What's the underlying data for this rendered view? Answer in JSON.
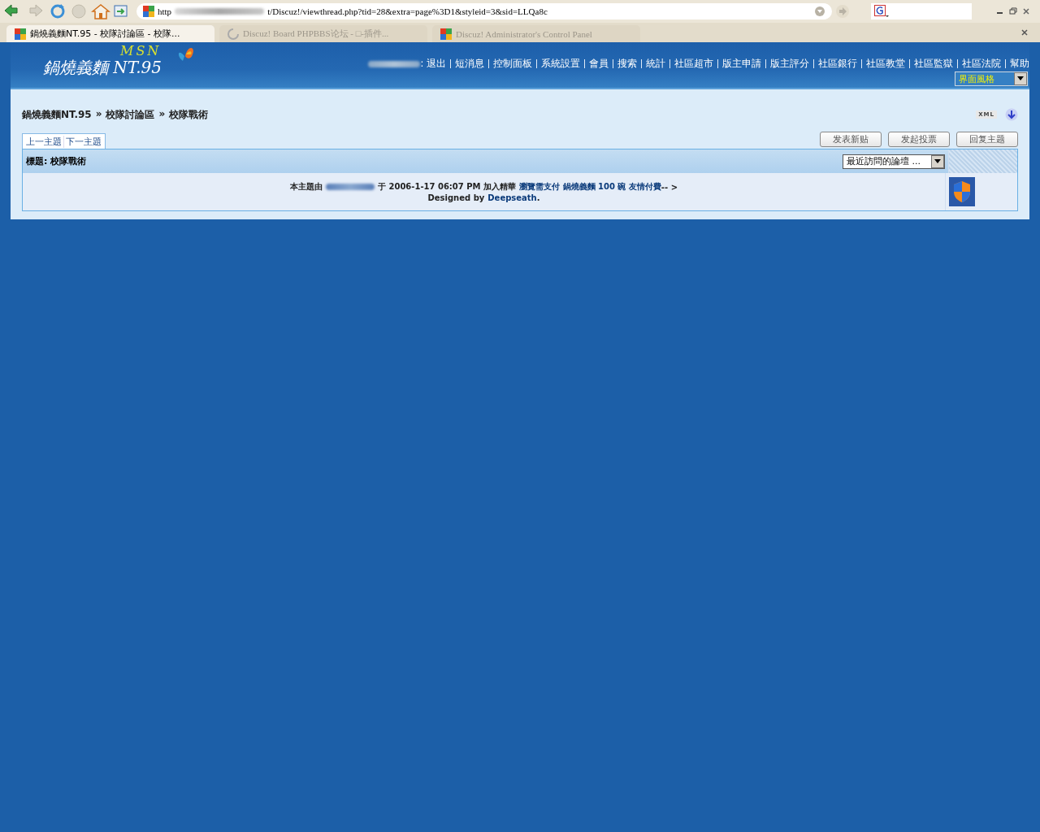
{
  "browser": {
    "url_start": "http",
    "url_end": "t/Discuz!/viewthread.php?tid=28&extra=page%3D1&styleid=3&sid=LLQa8c",
    "tabs": [
      {
        "title": "鍋燒義麵NT.95 - 校隊討論區 - 校隊...",
        "selected": true,
        "kind": "site"
      },
      {
        "title": "Discuz! Board PHPBBS论坛 - □-插件...",
        "selected": false,
        "kind": "loading"
      },
      {
        "title": "Discuz! Administrator's Control Panel",
        "selected": false,
        "kind": "site"
      }
    ]
  },
  "header": {
    "logo_text": "鍋燒義麵 NT.95",
    "logo_script": "MSN",
    "nav": [
      ":  退出",
      "短消息",
      "控制面板",
      "系統設置",
      "會員",
      "搜索",
      "統計",
      "社區超市",
      "版主申請",
      "版主評分",
      "社區銀行",
      "社區教堂",
      "社區監獄",
      "社區法院",
      "幫助"
    ],
    "style_select": "界面風格"
  },
  "breadcrumb": [
    "鍋燒義麵NT.95",
    "校隊討論區",
    "校隊戰術"
  ],
  "breadcrumb_sep": "»",
  "xml_badge": "XML",
  "thread_nav": [
    "上一主題",
    "下一主題"
  ],
  "actions": [
    "发表新贴",
    "发起投票",
    "回复主题"
  ],
  "thread": {
    "title": "標題: 校隊戰術",
    "forum_jump": "最近訪問的論壇 ...",
    "info_prefix": "本主題由",
    "info_middle": "于 2006-1-17 06:07 PM 加入精華",
    "info_link": "瀏覽需支付 鍋燒義麵 100 碗 友情付費",
    "info_suffix": "-- >",
    "designed_by": "Designed by",
    "designer": "Deepseath",
    "designer_end": "."
  }
}
